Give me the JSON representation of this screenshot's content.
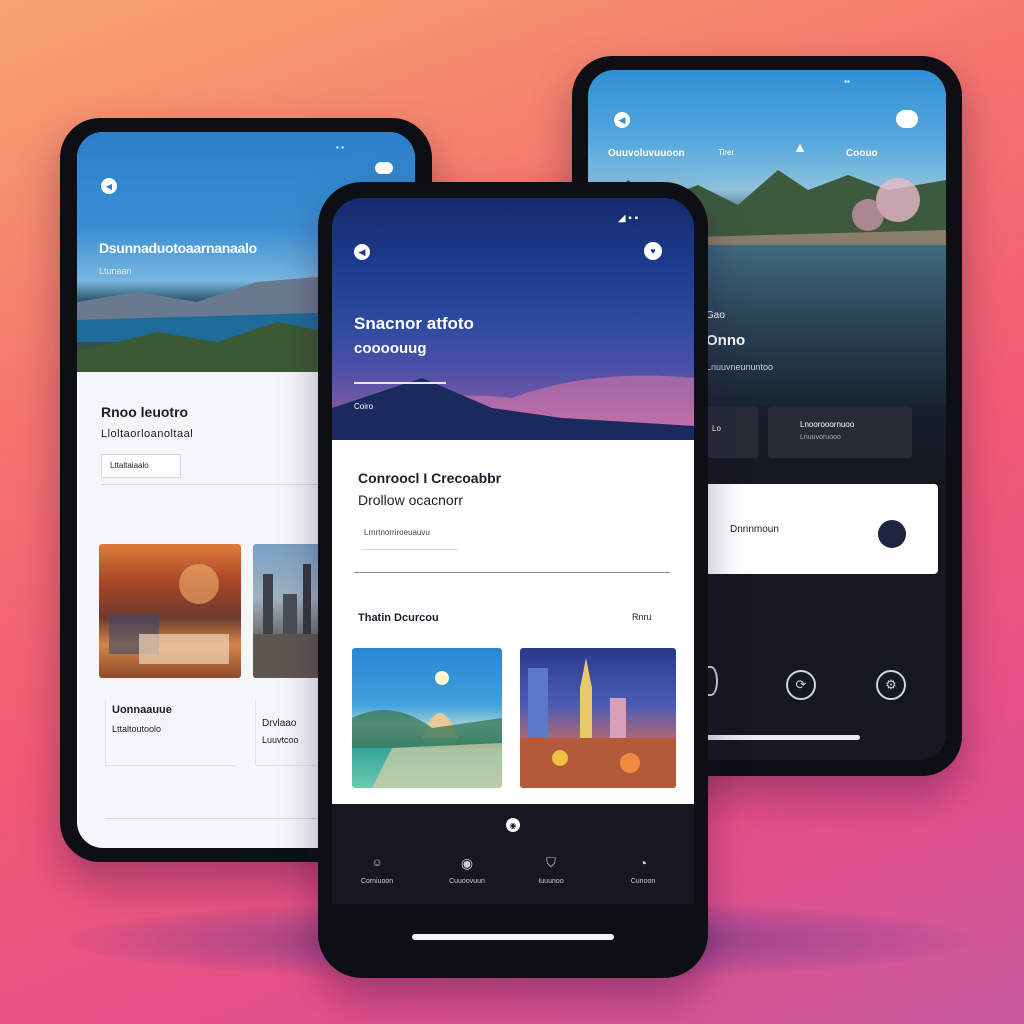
{
  "colors": {
    "accent": "#1c2a6b",
    "dark": "#13161e",
    "bg_top": "#f7a46e",
    "bg_bottom": "#c75aa0"
  },
  "left_phone": {
    "status_icons": [
      "wifi-icon",
      "cloud-icon"
    ],
    "hero_title": "Dsunnaduotoaarnanaalo",
    "hero_subtitle": "Ltunaan",
    "card_title": "Rnoo leuotro",
    "card_subtitle": "Lloltaorloanoltaal",
    "card_chip": "Lttaltaiaalo",
    "item1_title": "Uonnaauue",
    "item1_sub": "Lttaltoutoolo",
    "item2_title": "Drvlaao",
    "item2_sub": "Luuvtcoo"
  },
  "center_phone": {
    "status_icons": [
      "signal-icon",
      "wifi-icon",
      "battery-icon"
    ],
    "hero_title": "Snacnor atfoto",
    "hero_subtitle": "coooouug",
    "hero_small": "Coiro",
    "section_title": "Conroocl I Crecoabbr",
    "section_subtitle": "Drollow ocacnorr",
    "field_label": "Lrnrtnorriroeuauvu",
    "list_header": "Thatin Dcurcou",
    "list_header_link": "Rnru",
    "nav": [
      {
        "icon": "person-icon",
        "glyph": "☺",
        "label": "Corniuoon"
      },
      {
        "icon": "compass-icon",
        "glyph": "◉",
        "label": "Cuuoovuun"
      },
      {
        "icon": "bookmark-icon",
        "glyph": "⛉",
        "label": "Iuuunoo"
      },
      {
        "icon": "profile-icon",
        "glyph": "◔",
        "label": "Cunoon"
      }
    ]
  },
  "right_phone": {
    "status_icons": [
      "signal-icon",
      "wifi-icon",
      "battery-icon"
    ],
    "hero_tabs": [
      "Ouuvoluvuuoon",
      "Tirer",
      "Coouo"
    ],
    "hero_title": "Onno",
    "hero_small_top": "Gao",
    "hero_subtitle": "Lnuuvneununtoo",
    "tile_left_label": "Lo",
    "tile_right_label": "Lnoorooornuoo",
    "tile_right_sub": "Lnuuvoruooo",
    "cta_label": "Dnnnmoun",
    "nav_icons": [
      "home-icon",
      "refresh-icon",
      "settings-icon"
    ]
  }
}
